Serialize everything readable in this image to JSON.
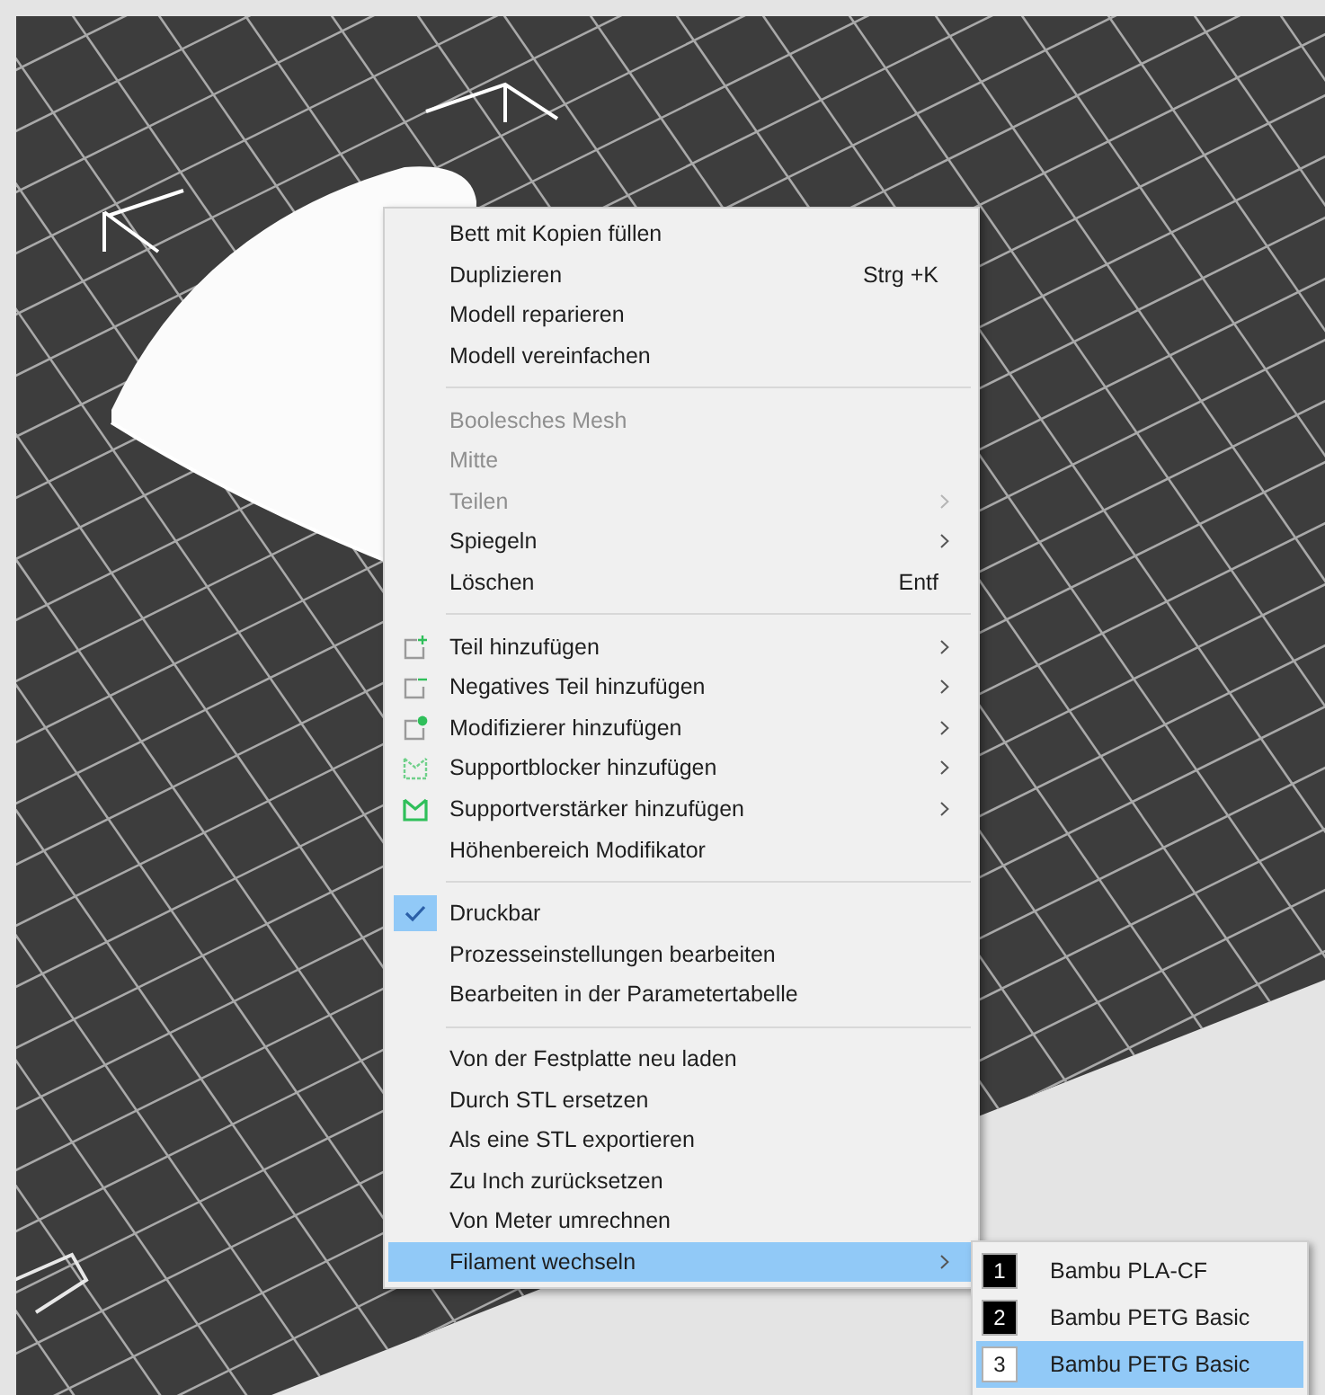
{
  "context_menu": {
    "sections": [
      [
        {
          "label": "Bett mit Kopien füllen",
          "disabled": false,
          "has_submenu": false,
          "selected": false
        },
        {
          "label": "Duplizieren",
          "shortcut": "Strg +K",
          "disabled": false,
          "has_submenu": false,
          "selected": false
        },
        {
          "label": "Modell reparieren",
          "disabled": false,
          "has_submenu": false,
          "selected": false
        },
        {
          "label": "Modell vereinfachen",
          "disabled": false,
          "has_submenu": false,
          "selected": false
        }
      ],
      [
        {
          "label": "Boolesches Mesh",
          "disabled": true,
          "has_submenu": false,
          "selected": false
        },
        {
          "label": "Mitte",
          "disabled": true,
          "has_submenu": false,
          "selected": false
        },
        {
          "label": "Teilen",
          "disabled": true,
          "has_submenu": true,
          "selected": false
        },
        {
          "label": "Spiegeln",
          "disabled": false,
          "has_submenu": true,
          "selected": false
        },
        {
          "label": "Löschen",
          "shortcut": "Entf",
          "disabled": false,
          "has_submenu": false,
          "selected": false
        }
      ],
      [
        {
          "label": "Teil hinzufügen",
          "kind": "add-part",
          "disabled": false,
          "has_submenu": true,
          "selected": false
        },
        {
          "label": "Negatives Teil hinzufügen",
          "kind": "negative-part",
          "disabled": false,
          "has_submenu": true,
          "selected": false
        },
        {
          "label": "Modifizierer hinzufügen",
          "kind": "modifier",
          "disabled": false,
          "has_submenu": true,
          "selected": false
        },
        {
          "label": "Supportblocker hinzufügen",
          "kind": "support-blocker",
          "disabled": false,
          "has_submenu": true,
          "selected": false
        },
        {
          "label": "Supportverstärker hinzufügen",
          "kind": "support-enforcer",
          "disabled": false,
          "has_submenu": true,
          "selected": false
        },
        {
          "label": "Höhenbereich Modifikator",
          "disabled": false,
          "has_submenu": false,
          "selected": false
        }
      ],
      [
        {
          "label": "Druckbar",
          "kind": "check",
          "checked": true,
          "disabled": false,
          "has_submenu": false,
          "selected": false
        },
        {
          "label": "Prozesseinstellungen bearbeiten",
          "disabled": false,
          "has_submenu": false,
          "selected": false
        },
        {
          "label": "Bearbeiten in der Parametertabelle",
          "disabled": false,
          "has_submenu": false,
          "selected": false
        }
      ],
      [
        {
          "label": "Von der Festplatte neu laden",
          "disabled": false,
          "has_submenu": false,
          "selected": false
        },
        {
          "label": "Durch STL ersetzen",
          "disabled": false,
          "has_submenu": false,
          "selected": false
        },
        {
          "label": "Als eine STL exportieren",
          "disabled": false,
          "has_submenu": false,
          "selected": false
        },
        {
          "label": "Zu Inch zurücksetzen",
          "disabled": false,
          "has_submenu": false,
          "selected": false
        },
        {
          "label": "Von Meter umrechnen",
          "disabled": false,
          "has_submenu": false,
          "selected": false
        },
        {
          "label": "Filament wechseln",
          "disabled": false,
          "has_submenu": true,
          "selected": true
        }
      ]
    ]
  },
  "filament_submenu": {
    "items": [
      {
        "number": "1",
        "label": "Bambu PLA-CF",
        "color": "#000000",
        "selected": false
      },
      {
        "number": "2",
        "label": "Bambu PETG Basic",
        "color": "#000000",
        "selected": false
      },
      {
        "number": "3",
        "label": "Bambu PETG Basic",
        "color": "#ffffff",
        "selected": true
      }
    ]
  }
}
